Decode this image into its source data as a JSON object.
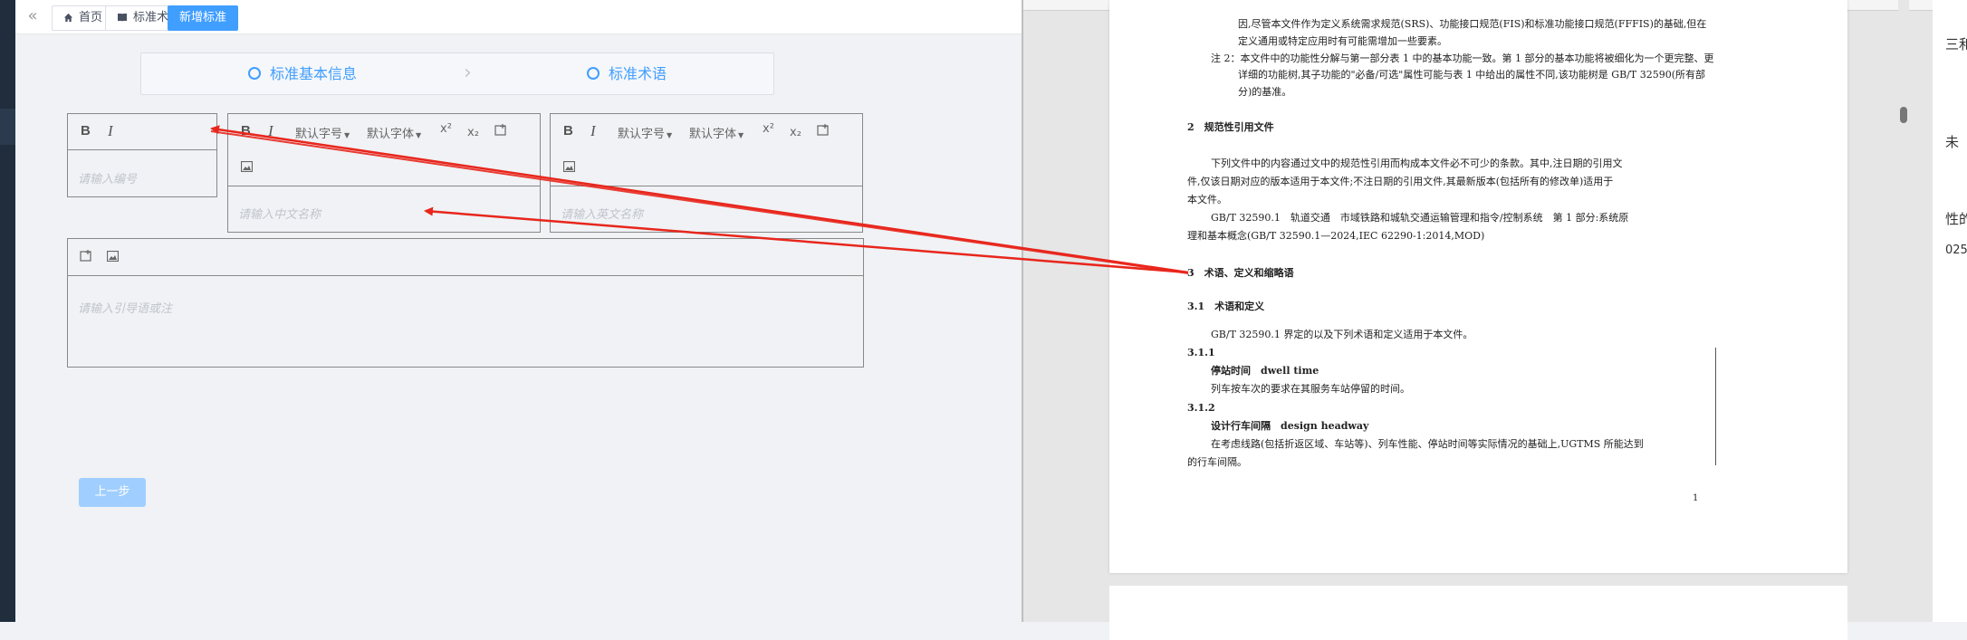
{
  "tabs": [
    {
      "label": "首页",
      "icon": "home-icon"
    },
    {
      "label": "标准术语库",
      "icon": "book-icon"
    },
    {
      "label": "新增标准",
      "active": true
    }
  ],
  "steps": [
    {
      "label": "标准基本信息"
    },
    {
      "label": "标准术语"
    }
  ],
  "editors": {
    "number": {
      "placeholder": "请输入编号"
    },
    "cn_name": {
      "placeholder": "请输入中文名称",
      "font_size": "默认字号",
      "font_family": "默认字体"
    },
    "en_name": {
      "placeholder": "请输入英文名称",
      "font_size": "默认字号",
      "font_family": "默认字体"
    },
    "intro": {
      "placeholder": "请输入引导语或注"
    }
  },
  "buttons": {
    "prev": "上一步"
  },
  "pdf": {
    "lines": [
      "因,尽管本文件作为定义系统需求规范(SRS)、功能接口规范(FIS)和标准功能接口规范(FFFIS)的基础,但在",
      "定义通用或特定应用时有可能需增加一些要素。",
      "注 2：本文件中的功能性分解与第一部分表 1 中的基本功能一致。第 1 部分的基本功能将被细化为一个更完整、更",
      "详细的功能树,其子功能的\"必备/可选\"属性可能与表 1 中给出的属性不同,该功能树是 GB/T 32590(所有部",
      "分)的基准。",
      "2　规范性引用文件",
      "下列文件中的内容通过文中的规范性引用而构成本文件必不可少的条款。其中,注日期的引用文",
      "件,仅该日期对应的版本适用于本文件;不注日期的引用文件,其最新版本(包括所有的修改单)适用于",
      "本文件。",
      "GB/T 32590.1　轨道交通　市域铁路和城轨交通运输管理和指令/控制系统　第 1 部分:系统原",
      "理和基本概念(GB/T 32590.1—2024,IEC 62290-1:2014,MOD)",
      "3　术语、定义和缩略语",
      "3.1　术语和定义",
      "GB/T 32590.1 界定的以及下列术语和定义适用于本文件。",
      "3.1.1",
      "停站时间　dwell time",
      "列车按车次的要求在其服务车站停留的时间。",
      "3.1.2",
      "设计行车间隔　design headway",
      "在考虑线路(包括折返区域、车站等)、列车性能、停站时间等实际情况的基础上,UGTMS 所能达到",
      "的行车间隔。"
    ],
    "page_number": "1"
  },
  "right_strip": [
    "三和",
    "未",
    "性的",
    "025"
  ],
  "colors": {
    "accent": "#409eff",
    "arrow": "#e8261c"
  }
}
